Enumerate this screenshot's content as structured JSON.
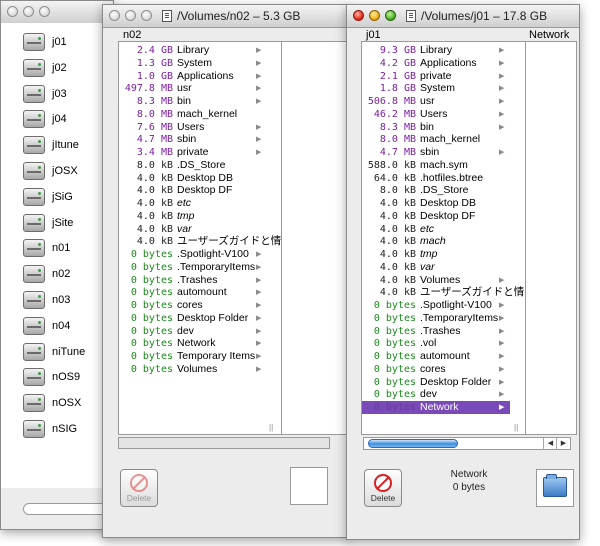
{
  "left_window": {
    "volumes": [
      "j01",
      "j02",
      "j03",
      "j04",
      "jItune",
      "jOSX",
      "jSiG",
      "jSite",
      "n01",
      "n02",
      "n03",
      "n04",
      "niTune",
      "nOS9",
      "nOSX",
      "nSIG"
    ]
  },
  "mid_window": {
    "title": "/Volumes/n02 – 5.3 GB",
    "column_header": "n02",
    "files": [
      {
        "size": "2.4 GB",
        "name": "Library",
        "unit": "gb",
        "arrow": true
      },
      {
        "size": "1.3 GB",
        "name": "System",
        "unit": "gb",
        "arrow": true
      },
      {
        "size": "1.0 GB",
        "name": "Applications",
        "unit": "gb",
        "arrow": true
      },
      {
        "size": "497.8 MB",
        "name": "usr",
        "unit": "mb",
        "arrow": true
      },
      {
        "size": "8.3 MB",
        "name": "bin",
        "unit": "mb",
        "arrow": true
      },
      {
        "size": "8.0 MB",
        "name": "mach_kernel",
        "unit": "mb",
        "arrow": false
      },
      {
        "size": "7.6 MB",
        "name": "Users",
        "unit": "mb",
        "arrow": true
      },
      {
        "size": "4.7 MB",
        "name": "sbin",
        "unit": "mb",
        "arrow": true
      },
      {
        "size": "3.4 MB",
        "name": "private",
        "unit": "mb",
        "arrow": true
      },
      {
        "size": "8.0 kB",
        "name": ".DS_Store",
        "unit": "kb",
        "arrow": false
      },
      {
        "size": "4.0 kB",
        "name": "Desktop DB",
        "unit": "kb",
        "arrow": false
      },
      {
        "size": "4.0 kB",
        "name": "Desktop DF",
        "unit": "kb",
        "arrow": false
      },
      {
        "size": "4.0 kB",
        "name": "etc",
        "unit": "kb",
        "arrow": false,
        "italic": true
      },
      {
        "size": "4.0 kB",
        "name": "tmp",
        "unit": "kb",
        "arrow": false,
        "italic": true
      },
      {
        "size": "4.0 kB",
        "name": "var",
        "unit": "kb",
        "arrow": false,
        "italic": true
      },
      {
        "size": "4.0 kB",
        "name": "ユーザーズガイドと情",
        "unit": "kb",
        "arrow": false
      },
      {
        "size": "0 bytes",
        "name": ".Spotlight-V100",
        "unit": "by",
        "arrow": true
      },
      {
        "size": "0 bytes",
        "name": ".TemporaryItems",
        "unit": "by",
        "arrow": true
      },
      {
        "size": "0 bytes",
        "name": ".Trashes",
        "unit": "by",
        "arrow": true
      },
      {
        "size": "0 bytes",
        "name": "automount",
        "unit": "by",
        "arrow": true
      },
      {
        "size": "0 bytes",
        "name": "cores",
        "unit": "by",
        "arrow": true
      },
      {
        "size": "0 bytes",
        "name": "Desktop Folder",
        "unit": "by",
        "arrow": true
      },
      {
        "size": "0 bytes",
        "name": "dev",
        "unit": "by",
        "arrow": true
      },
      {
        "size": "0 bytes",
        "name": "Network",
        "unit": "by",
        "arrow": true
      },
      {
        "size": "0 bytes",
        "name": "Temporary Items",
        "unit": "by",
        "arrow": true
      },
      {
        "size": "0 bytes",
        "name": "Volumes",
        "unit": "by",
        "arrow": true
      }
    ],
    "delete_label": "Delete"
  },
  "right_window": {
    "title": "/Volumes/j01 – 17.8 GB",
    "column_header": "j01",
    "column2_header": "Network",
    "files": [
      {
        "size": "9.3 GB",
        "name": "Library",
        "unit": "gb",
        "arrow": true
      },
      {
        "size": "4.2 GB",
        "name": "Applications",
        "unit": "gb",
        "arrow": true
      },
      {
        "size": "2.1 GB",
        "name": "private",
        "unit": "gb",
        "arrow": true
      },
      {
        "size": "1.8 GB",
        "name": "System",
        "unit": "gb",
        "arrow": true
      },
      {
        "size": "506.8 MB",
        "name": "usr",
        "unit": "mb",
        "arrow": true
      },
      {
        "size": "46.2 MB",
        "name": "Users",
        "unit": "mb",
        "arrow": true
      },
      {
        "size": "8.3 MB",
        "name": "bin",
        "unit": "mb",
        "arrow": true
      },
      {
        "size": "8.0 MB",
        "name": "mach_kernel",
        "unit": "mb",
        "arrow": false
      },
      {
        "size": "4.7 MB",
        "name": "sbin",
        "unit": "mb",
        "arrow": true
      },
      {
        "size": "588.0 kB",
        "name": "mach.sym",
        "unit": "kb",
        "arrow": false
      },
      {
        "size": "64.0 kB",
        "name": ".hotfiles.btree",
        "unit": "kb",
        "arrow": false
      },
      {
        "size": "8.0 kB",
        "name": ".DS_Store",
        "unit": "kb",
        "arrow": false
      },
      {
        "size": "4.0 kB",
        "name": "Desktop DB",
        "unit": "kb",
        "arrow": false
      },
      {
        "size": "4.0 kB",
        "name": "Desktop DF",
        "unit": "kb",
        "arrow": false
      },
      {
        "size": "4.0 kB",
        "name": "etc",
        "unit": "kb",
        "arrow": false,
        "italic": true
      },
      {
        "size": "4.0 kB",
        "name": "mach",
        "unit": "kb",
        "arrow": false,
        "italic": true
      },
      {
        "size": "4.0 kB",
        "name": "tmp",
        "unit": "kb",
        "arrow": false,
        "italic": true
      },
      {
        "size": "4.0 kB",
        "name": "var",
        "unit": "kb",
        "arrow": false,
        "italic": true
      },
      {
        "size": "4.0 kB",
        "name": "Volumes",
        "unit": "kb",
        "arrow": true
      },
      {
        "size": "4.0 kB",
        "name": "ユーザーズガイドと情",
        "unit": "kb",
        "arrow": false
      },
      {
        "size": "0 bytes",
        "name": ".Spotlight-V100",
        "unit": "by",
        "arrow": true
      },
      {
        "size": "0 bytes",
        "name": ".TemporaryItems",
        "unit": "by",
        "arrow": true
      },
      {
        "size": "0 bytes",
        "name": ".Trashes",
        "unit": "by",
        "arrow": true
      },
      {
        "size": "0 bytes",
        "name": ".vol",
        "unit": "by",
        "arrow": true
      },
      {
        "size": "0 bytes",
        "name": "automount",
        "unit": "by",
        "arrow": true
      },
      {
        "size": "0 bytes",
        "name": "cores",
        "unit": "by",
        "arrow": true
      },
      {
        "size": "0 bytes",
        "name": "Desktop Folder",
        "unit": "by",
        "arrow": true
      },
      {
        "size": "0 bytes",
        "name": "dev",
        "unit": "by",
        "arrow": true
      },
      {
        "size": "0 bytes",
        "name": "Network",
        "unit": "by",
        "arrow": true,
        "selected": true
      }
    ],
    "delete_label": "Delete",
    "info_name": "Network",
    "info_size": "0 bytes"
  },
  "colors": {
    "large_size": "#7a1fa0",
    "kb_size": "#222222",
    "zero_size": "#1c8a1c",
    "selection": "#7a4ab8",
    "scroll_thumb": "#3e8ede"
  }
}
